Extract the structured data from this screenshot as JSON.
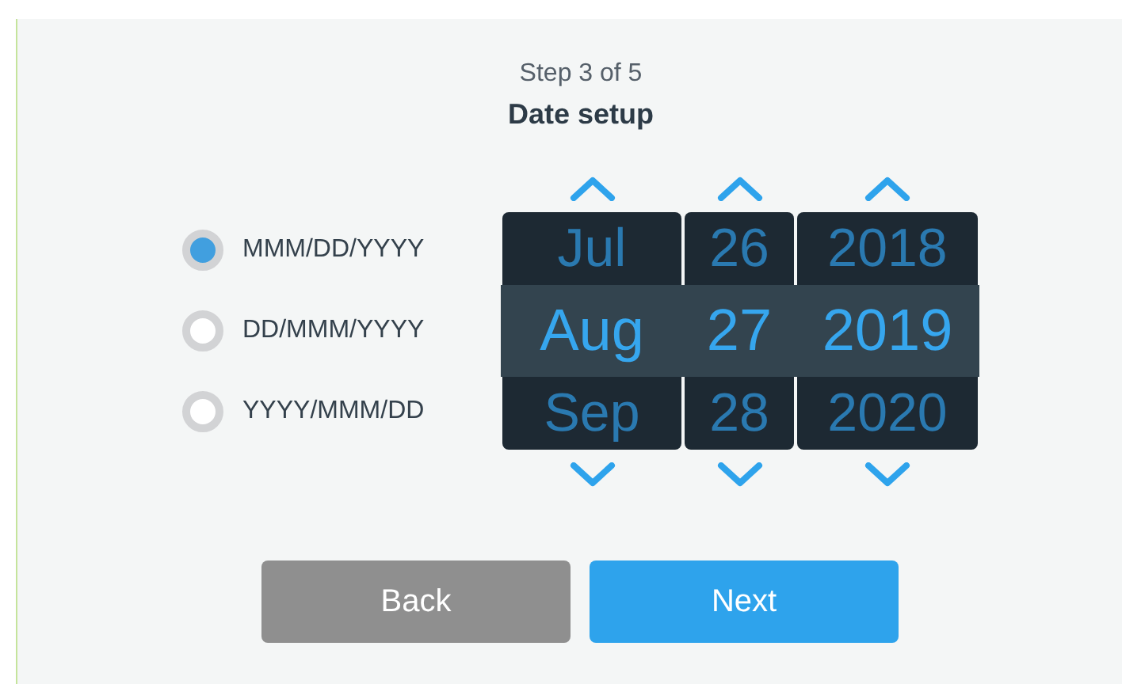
{
  "header": {
    "step": "Step 3 of 5",
    "title": "Date setup"
  },
  "formats": [
    {
      "label": "MMM/DD/YYYY",
      "selected": true
    },
    {
      "label": "DD/MMM/YYYY",
      "selected": false
    },
    {
      "label": "YYYY/MMM/DD",
      "selected": false
    }
  ],
  "picker": {
    "columns": [
      {
        "items": [
          {
            "label": "Jul",
            "selected": false
          },
          {
            "label": "Aug",
            "selected": true
          },
          {
            "label": "Sep",
            "selected": false
          }
        ]
      },
      {
        "items": [
          {
            "label": "26",
            "selected": false
          },
          {
            "label": "27",
            "selected": true
          },
          {
            "label": "28",
            "selected": false
          }
        ]
      },
      {
        "items": [
          {
            "label": "2018",
            "selected": false
          },
          {
            "label": "2019",
            "selected": true
          },
          {
            "label": "2020",
            "selected": false
          }
        ]
      }
    ]
  },
  "buttons": [
    {
      "label": "Back",
      "kind": "secondary"
    },
    {
      "label": "Next",
      "kind": "primary"
    }
  ]
}
